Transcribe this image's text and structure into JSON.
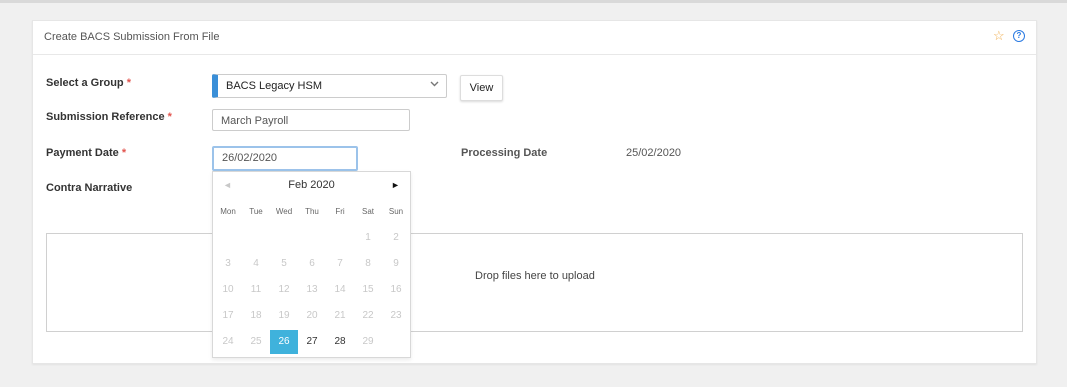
{
  "card": {
    "title": "Create BACS Submission From File",
    "star_icon": "star-outline-icon",
    "help_icon": "question-circle-icon",
    "accent_color": "#3a8fd8"
  },
  "form": {
    "group_label": "Select a Group",
    "group_value": "BACS Legacy HSM",
    "view_button": "View",
    "submission_reference_label": "Submission Reference",
    "submission_reference_value": "March Payroll",
    "payment_date_label": "Payment Date",
    "payment_date_value": "26/02/2020",
    "processing_date_label": "Processing Date",
    "processing_date_value": "25/02/2020",
    "contra_narrative_label": "Contra Narrative",
    "required_mark": "*"
  },
  "datepicker": {
    "month_title": "Feb 2020",
    "prev_symbol": "◄",
    "next_symbol": "►",
    "weekdays": [
      "Mon",
      "Tue",
      "Wed",
      "Thu",
      "Fri",
      "Sat",
      "Sun"
    ],
    "weeks": [
      [
        "",
        "",
        "",
        "",
        "",
        "1",
        "2"
      ],
      [
        "3",
        "4",
        "5",
        "6",
        "7",
        "8",
        "9"
      ],
      [
        "10",
        "11",
        "12",
        "13",
        "14",
        "15",
        "16"
      ],
      [
        "17",
        "18",
        "19",
        "20",
        "21",
        "22",
        "23"
      ],
      [
        "24",
        "25",
        "26",
        "27",
        "28",
        "29",
        ""
      ]
    ],
    "selected_day": "26",
    "available_days": [
      "27",
      "28"
    ],
    "selected_color": "#3fb2dc"
  },
  "dropzone": {
    "text": "Drop files here to upload"
  }
}
